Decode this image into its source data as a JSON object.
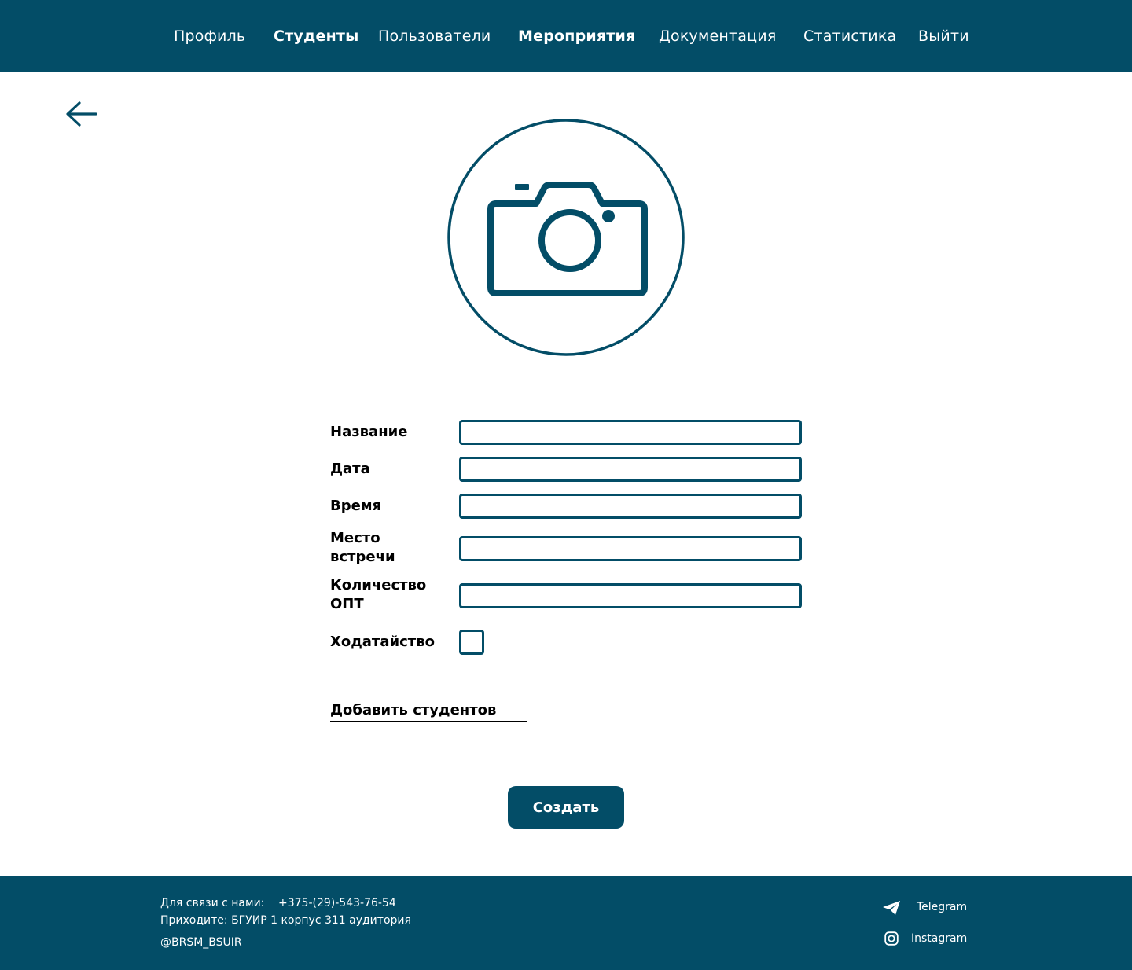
{
  "nav": {
    "items": [
      {
        "label": "Профиль",
        "bold": false
      },
      {
        "label": "Студенты",
        "bold": true
      },
      {
        "label": "Пользователи",
        "bold": false
      },
      {
        "label": "Мероприятия",
        "bold": true
      },
      {
        "label": "Документация",
        "bold": false
      },
      {
        "label": "Статистика",
        "bold": false
      },
      {
        "label": "Выйти",
        "bold": false
      }
    ]
  },
  "back": {
    "icon": "arrow-left-icon"
  },
  "photo": {
    "icon": "camera-icon"
  },
  "form": {
    "name_label": "Название",
    "name_value": "",
    "date_label": "Дата",
    "date_value": "",
    "time_label": "Время",
    "time_value": "",
    "place_label_line1": "Место",
    "place_label_line2": "встречи",
    "place_value": "",
    "opt_label_line1": "Количество",
    "opt_label_line2": "ОПТ",
    "opt_value": "",
    "petition_label": "Ходатайство",
    "petition_checked": false
  },
  "add_students_link": "Добавить студентов",
  "create_button": "Создать",
  "footer": {
    "contact_label": "Для связи с нами:",
    "phone": "+375-(29)-543-76-54",
    "address": "Приходите: БГУИР 1 корпус 311 аудитория",
    "handle": "@BRSM_BSUIR",
    "telegram": "Telegram",
    "instagram": "Instagram"
  },
  "colors": {
    "primary": "#034d67",
    "background": "#ffffff",
    "text": "#000000"
  }
}
